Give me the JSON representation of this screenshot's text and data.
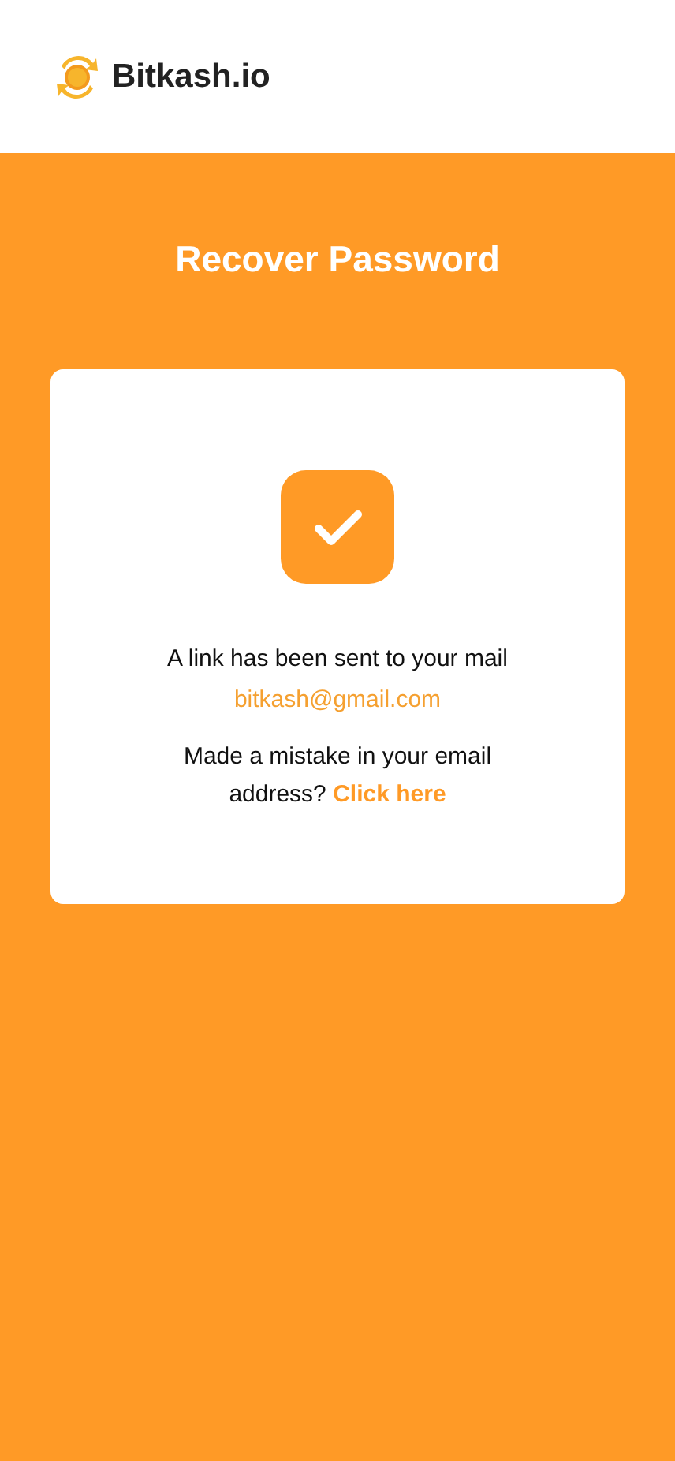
{
  "header": {
    "logo_text": "Bitkash.io"
  },
  "title": "Recover Password",
  "card": {
    "message": "A link has been sent to your mail",
    "email": "bitkash@gmail.com",
    "mistake_text": "Made a  mistake in your email address?",
    "link": "Click here"
  }
}
